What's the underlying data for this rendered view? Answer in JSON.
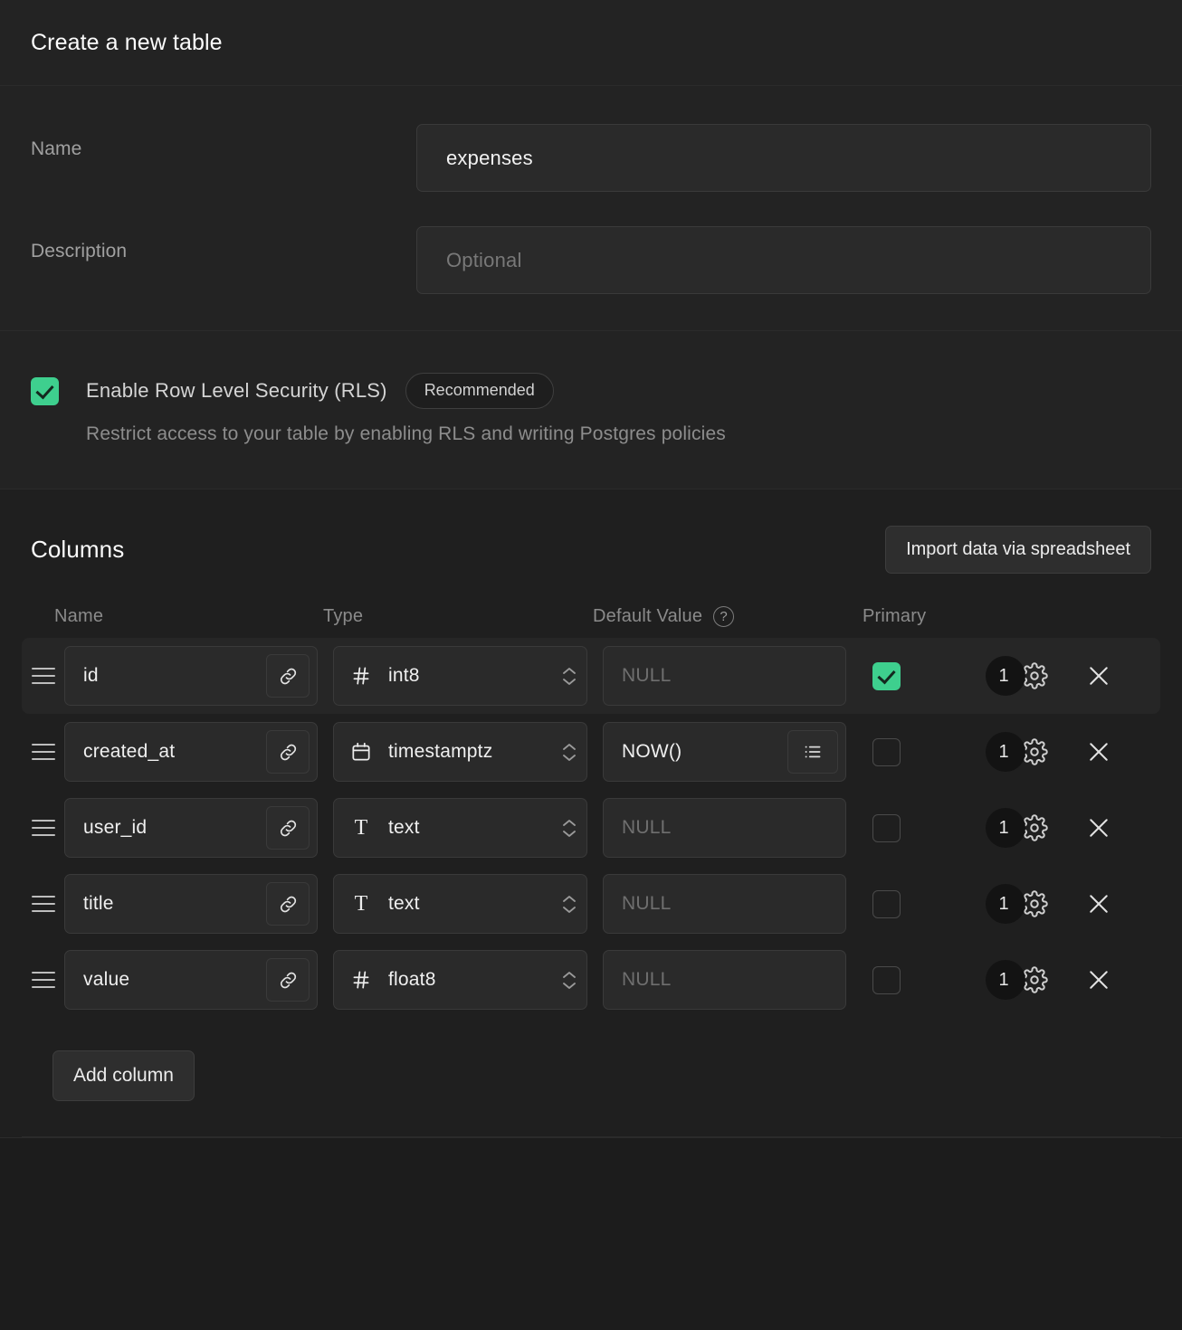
{
  "header": {
    "title": "Create a new table"
  },
  "form": {
    "name": {
      "label": "Name",
      "value": "expenses",
      "placeholder": ""
    },
    "description": {
      "label": "Description",
      "value": "",
      "placeholder": "Optional"
    }
  },
  "rls": {
    "checked": true,
    "label": "Enable Row Level Security (RLS)",
    "badge": "Recommended",
    "description": "Restrict access to your table by enabling RLS and writing Postgres policies"
  },
  "columns": {
    "title": "Columns",
    "import_button": "Import data via spreadsheet",
    "add_button": "Add column",
    "headers": {
      "name": "Name",
      "type": "Type",
      "default_value": "Default Value",
      "help": "?",
      "primary": "Primary"
    },
    "rows": [
      {
        "name": "id",
        "type": "int8",
        "type_icon": "hash-icon",
        "default_value": "NULL",
        "default_is_placeholder": true,
        "has_list_button": false,
        "primary": true,
        "badge": "1"
      },
      {
        "name": "created_at",
        "type": "timestamptz",
        "type_icon": "calendar-icon",
        "default_value": "NOW()",
        "default_is_placeholder": false,
        "has_list_button": true,
        "primary": false,
        "badge": "1"
      },
      {
        "name": "user_id",
        "type": "text",
        "type_icon": "text-icon",
        "default_value": "NULL",
        "default_is_placeholder": true,
        "has_list_button": false,
        "primary": false,
        "badge": "1"
      },
      {
        "name": "title",
        "type": "text",
        "type_icon": "text-icon",
        "default_value": "NULL",
        "default_is_placeholder": true,
        "has_list_button": false,
        "primary": false,
        "badge": "1"
      },
      {
        "name": "value",
        "type": "float8",
        "type_icon": "hash-icon",
        "default_value": "NULL",
        "default_is_placeholder": true,
        "has_list_button": false,
        "primary": false,
        "badge": "1"
      }
    ]
  },
  "colors": {
    "accent_green": "#3ECF8E",
    "panel_bg": "#232323",
    "page_bg": "#1C1C1C",
    "field_bg": "#2A2A2A",
    "border": "#3A3A3A"
  }
}
